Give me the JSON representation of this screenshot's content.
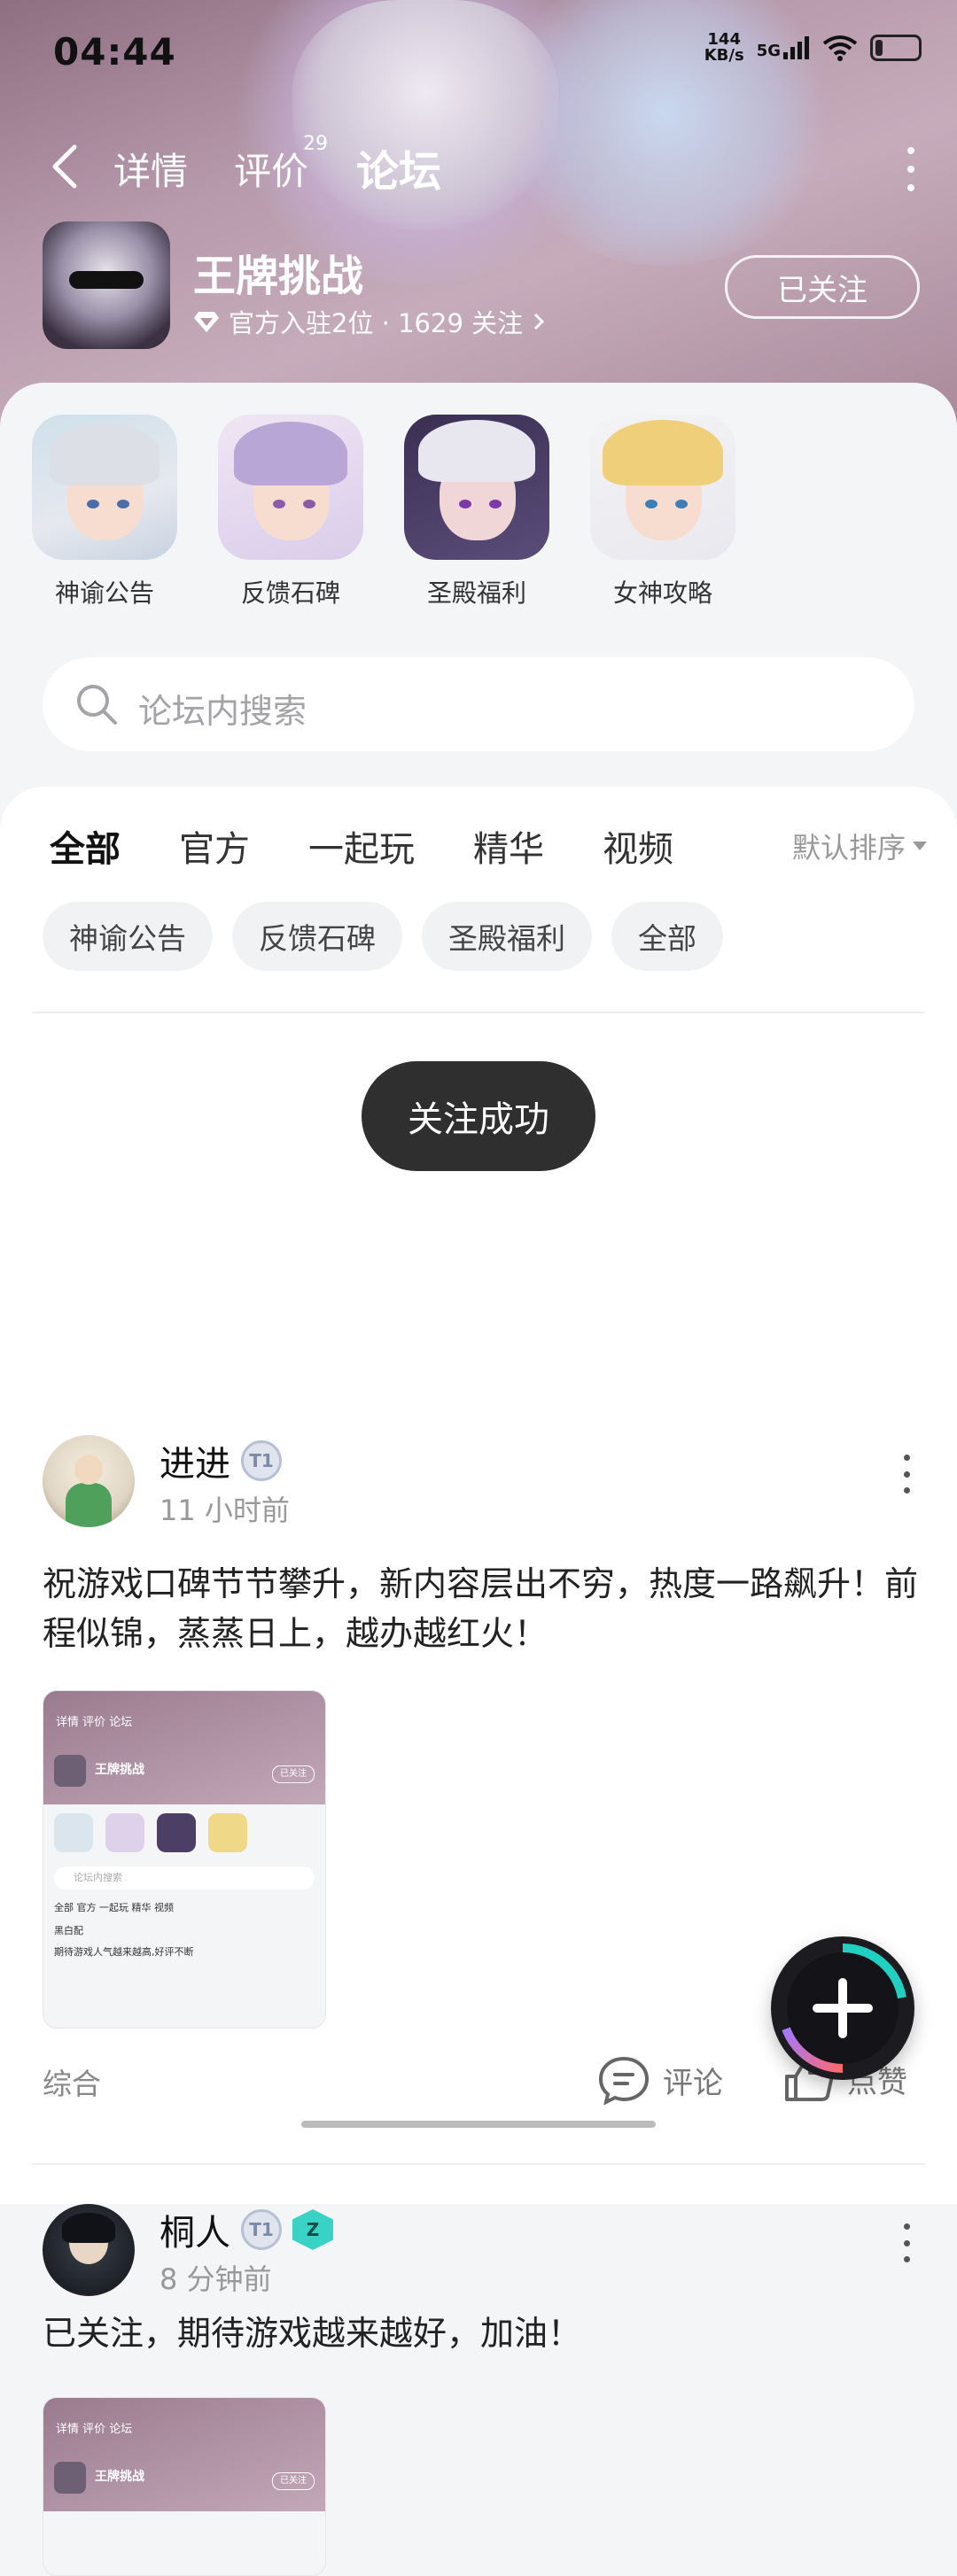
{
  "status": {
    "time": "04:44",
    "net_speed_value": "144",
    "net_speed_unit": "KB/s",
    "network": "5G"
  },
  "nav": {
    "tabs": [
      {
        "label": "详情"
      },
      {
        "label": "评价",
        "badge": "29"
      },
      {
        "label": "论坛"
      }
    ],
    "active_tab": "论坛",
    "accent": "#2bd6c0"
  },
  "game": {
    "title": "王牌挑战",
    "meta": "官方入驻2位 · 1629 关注",
    "follow_label": "已关注"
  },
  "shortcuts": [
    {
      "label": "神谕公告"
    },
    {
      "label": "反馈石碑"
    },
    {
      "label": "圣殿福利"
    },
    {
      "label": "女神攻略"
    }
  ],
  "search": {
    "placeholder": "论坛内搜索"
  },
  "feed_tabs": [
    {
      "label": "全部"
    },
    {
      "label": "官方"
    },
    {
      "label": "一起玩"
    },
    {
      "label": "精华"
    },
    {
      "label": "视频"
    }
  ],
  "sort_label": "默认排序",
  "chips": [
    {
      "label": "神谕公告"
    },
    {
      "label": "反馈石碑"
    },
    {
      "label": "圣殿福利"
    },
    {
      "label": "全部"
    }
  ],
  "posts": [
    {
      "user": "进进",
      "time": "11 小时前",
      "text": "祝游戏口碑节节攀升，新内容层出不穷，热度一路飙升！前程似锦，蒸蒸日上，越办越红火！",
      "category": "综合",
      "comment_label": "评论",
      "like_label": "点赞",
      "thumb": {
        "tabs": "详情   评价   论坛",
        "title": "王牌挑战",
        "follow": "已关注",
        "search": "论坛内搜索",
        "tabs2": "全部   官方   一起玩   精华   视频",
        "line": "黑白配",
        "text": "期待游戏人气越来越高,好评不断"
      }
    },
    {
      "user": "桐人",
      "time": "8 分钟前",
      "text": "已关注，期待游戏越来越好，加油！",
      "thumb": {
        "tabs": "详情   评价   论坛",
        "title": "王牌挑战",
        "follow": "已关注"
      }
    }
  ],
  "toast": "关注成功"
}
